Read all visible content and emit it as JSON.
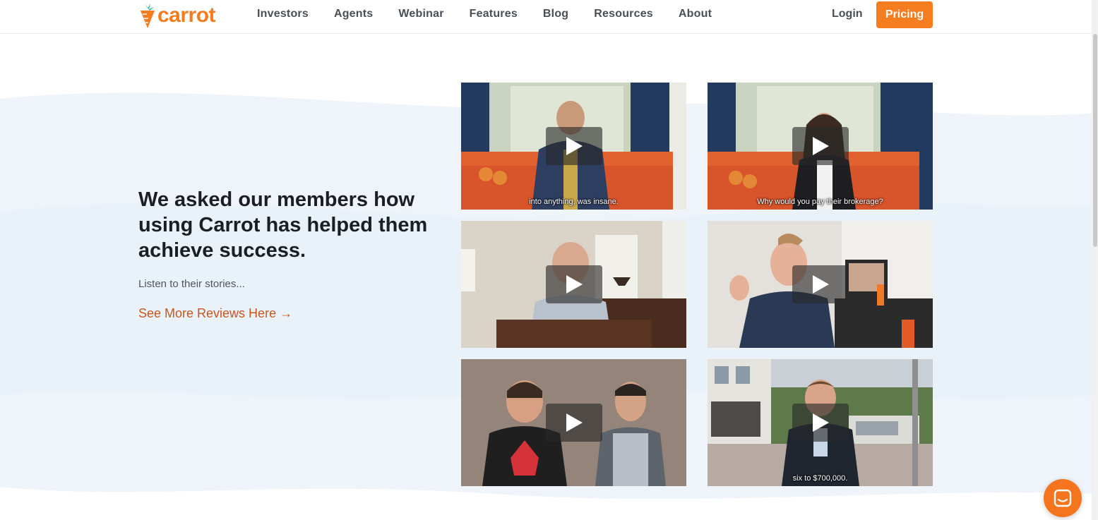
{
  "brand": {
    "name": "carrot",
    "color": "#f47c20"
  },
  "nav": {
    "items": [
      "Investors",
      "Agents",
      "Webinar",
      "Features",
      "Blog",
      "Resources",
      "About"
    ],
    "login_label": "Login",
    "pricing_label": "Pricing"
  },
  "hero": {
    "headline_line1": "We asked our members how",
    "headline_line2": "using Carrot has helped them",
    "headline_line3": "achieve success.",
    "subtext": "Listen to their stories...",
    "link_label": "See More Reviews Here →"
  },
  "videos": [
    {
      "caption": "into anything, was insane."
    },
    {
      "caption": "Why would you pay their brokerage?"
    },
    {
      "caption": ""
    },
    {
      "caption": ""
    },
    {
      "caption": ""
    },
    {
      "caption": "six to $700,000."
    }
  ],
  "colors": {
    "accent": "#f57c1f",
    "link": "#c9561e",
    "text": "#1b1f24"
  },
  "icons": {
    "play": "play-icon",
    "chat": "chat-icon",
    "logo": "carrot-logo-icon"
  }
}
